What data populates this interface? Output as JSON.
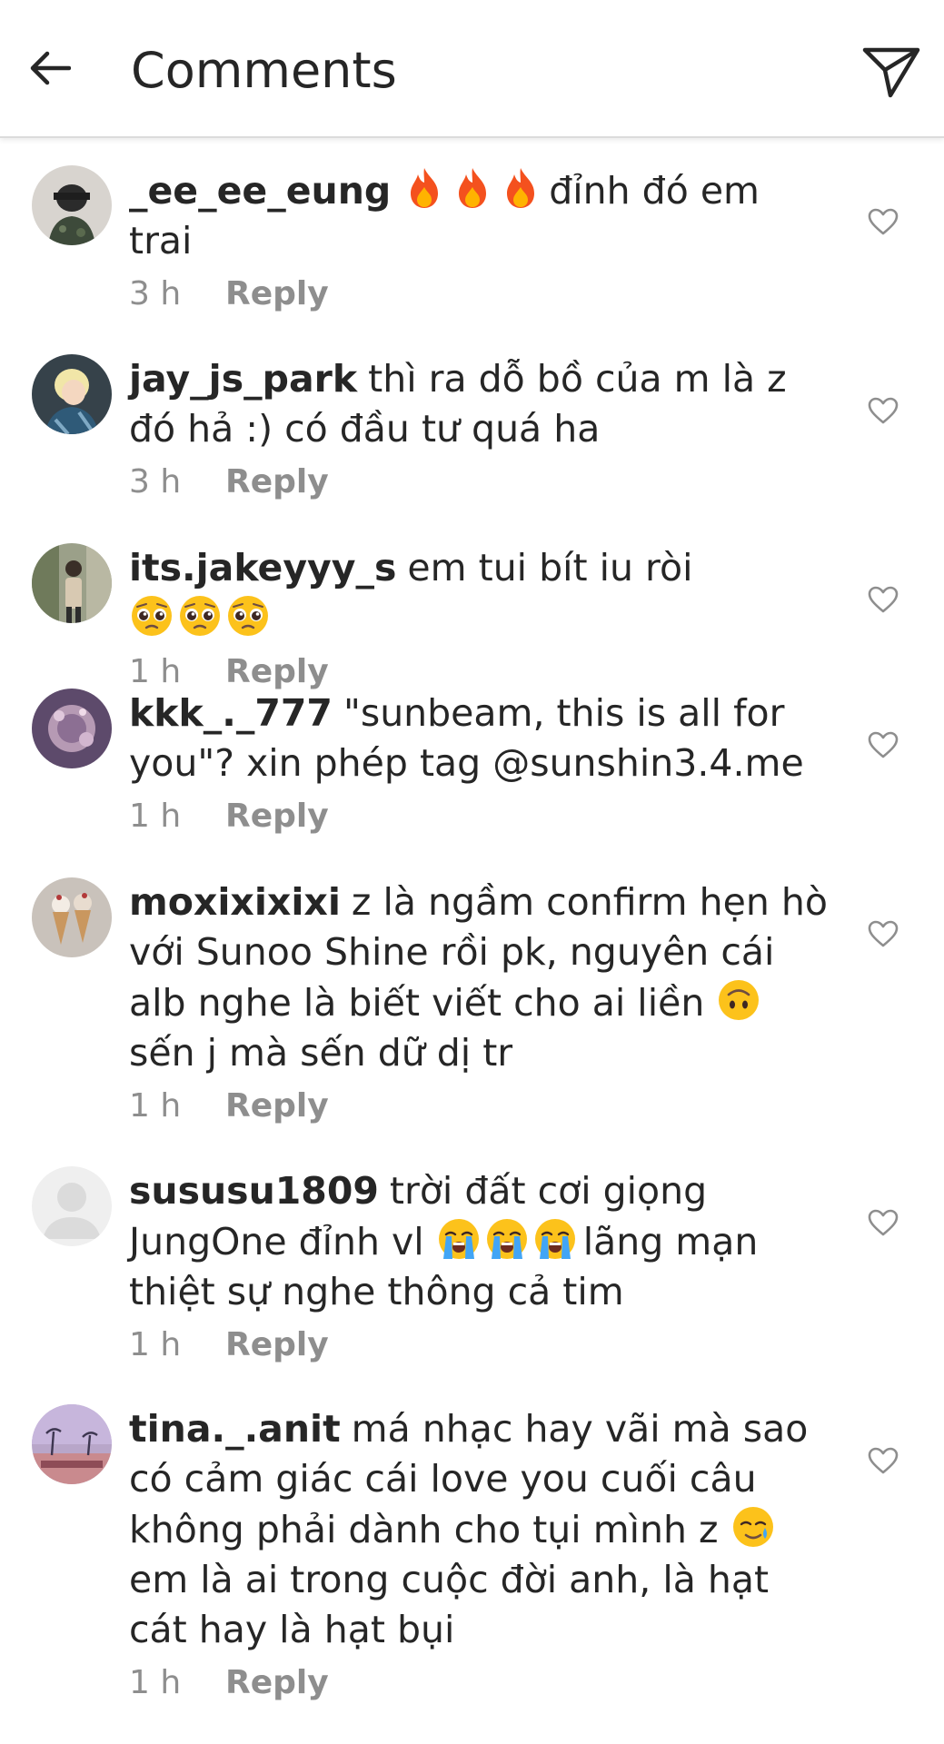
{
  "header": {
    "title": "Comments",
    "back_icon": "arrow-left-icon",
    "send_icon": "paper-plane-icon"
  },
  "reply_label": "Reply",
  "comments": [
    {
      "username": "_ee_ee_eung",
      "emojis": [
        "fire",
        "fire",
        "fire"
      ],
      "text_before": "",
      "text_after": "đỉnh đó em trai",
      "time": "3 h"
    },
    {
      "username": "jay_js_park",
      "emojis": [],
      "text_before": "thì ra dỗ bồ của m là z đó hả :) có đầu tư quá ha",
      "text_after": "",
      "time": "3 h"
    },
    {
      "username": "its.jakeyyy_s",
      "emojis": [
        "pleading-face",
        "pleading-face",
        "pleading-face"
      ],
      "text_before": "em tui bít iu ròi",
      "text_after": "",
      "time": "1 h"
    },
    {
      "username": "kkk_._777",
      "emojis": [],
      "text_before": "\"sunbeam, this is all for you\"? xin phép tag @sunshin3.4.me",
      "text_after": "",
      "time": "1 h"
    },
    {
      "username": "moxixixixi",
      "emojis": [
        "upside-down-face"
      ],
      "text_before": "z là ngầm confirm hẹn hò với Sunoo Shine rồi pk, nguyên cái alb nghe là biết viết cho ai liền",
      "text_after": "sến j mà sến dữ dị tr",
      "time": "1 h"
    },
    {
      "username": "sususu1809",
      "emojis": [
        "loudly-crying-face",
        "loudly-crying-face",
        "loudly-crying-face"
      ],
      "text_before": "trời đất cơi giọng JungOne đỉnh vl",
      "text_after": "lãng mạn thiệt sự nghe thông cả tim",
      "time": "1 h"
    },
    {
      "username": "tina._.anit",
      "emojis": [
        "smiling-face-with-tear"
      ],
      "text_before": "má nhạc hay vãi mà sao có cảm giác cái love you cuối câu không phải dành cho tụi mình z",
      "text_after": "em là ai trong cuộc đời anh, là hạt cát hay là hạt bụi",
      "time": "1 h"
    }
  ],
  "colors": {
    "text": "#262626",
    "secondary": "#8e8e8e",
    "divider": "#dbdbdb"
  }
}
